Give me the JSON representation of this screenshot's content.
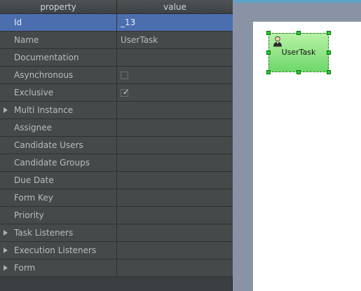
{
  "header": {
    "property": "property",
    "value": "value"
  },
  "rows": [
    {
      "label": "Id",
      "value": "_13"
    },
    {
      "label": "Name",
      "value": "UserTask"
    },
    {
      "label": "Documentation",
      "value": ""
    },
    {
      "label": "Asynchronous",
      "value": ""
    },
    {
      "label": "Exclusive",
      "value": ""
    },
    {
      "label": "Multi Instance",
      "value": ""
    },
    {
      "label": "Assignee",
      "value": ""
    },
    {
      "label": "Candidate Users",
      "value": ""
    },
    {
      "label": "Candidate Groups",
      "value": ""
    },
    {
      "label": "Due Date",
      "value": ""
    },
    {
      "label": "Form Key",
      "value": ""
    },
    {
      "label": "Priority",
      "value": ""
    },
    {
      "label": "Task Listeners",
      "value": ""
    },
    {
      "label": "Execution Listeners",
      "value": ""
    },
    {
      "label": "Form",
      "value": ""
    }
  ],
  "checkboxes": {
    "asynchronous_checked": false,
    "exclusive_checked": true
  },
  "task": {
    "label": "UserTask",
    "icon": "user-icon"
  },
  "colors": {
    "selected_row": "#4b6eaf",
    "task_fill_top": "#b8f2a6",
    "task_fill_bottom": "#6ed86a",
    "handle": "#22d32a",
    "accent_bar": "#5da2c9"
  }
}
